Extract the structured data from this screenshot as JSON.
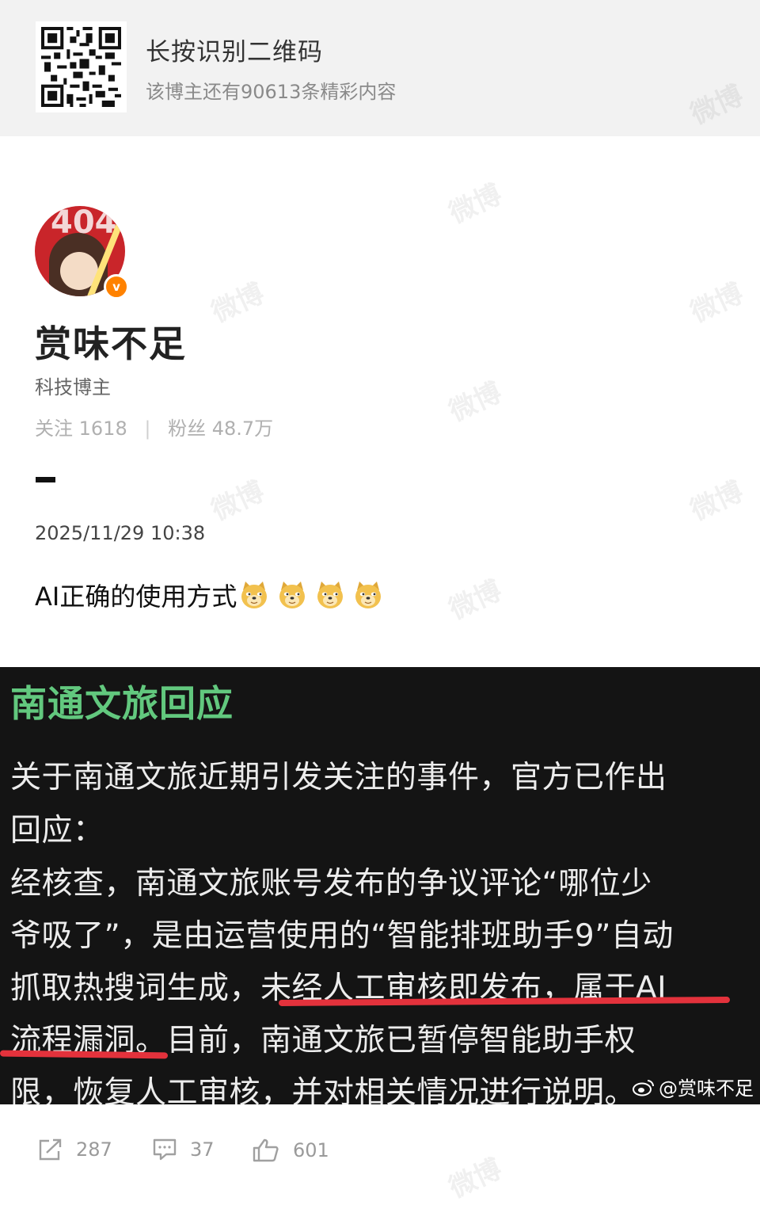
{
  "banner": {
    "title": "长按识别二维码",
    "subtitle": "该博主还有90613条精彩内容"
  },
  "profile": {
    "name": "赏味不足",
    "tag": "科技博主",
    "follow_label": "关注",
    "follow_count": "1618",
    "fans_label": "粉丝",
    "fans_count": "48.7万",
    "verified_mark": "v",
    "avatar_text": "404"
  },
  "post": {
    "timestamp": "2025/11/29 10:38",
    "text": "AI正确的使用方式",
    "emoji_count": 4
  },
  "screenshot": {
    "title": "南通文旅回应",
    "lines": [
      "关于南通文旅近期引发关注的事件，官方已作出",
      "回应：",
      "经核查，南通文旅账号发布的争议评论“哪位少",
      "爷吸了”，是由运营使用的“智能排班助手9”自动",
      "抓取热搜词生成，未经人工审核即发布，属于AI",
      "流程漏洞。目前，南通文旅已暂停智能助手权",
      "限，恢复人工审核，并对相关情况进行说明。"
    ],
    "credit": "@赏味不足",
    "underline_color": "#e3323c",
    "title_color": "#62c87e"
  },
  "actions": {
    "share_count": "287",
    "comment_count": "37",
    "like_count": "601"
  },
  "watermark": "微博"
}
